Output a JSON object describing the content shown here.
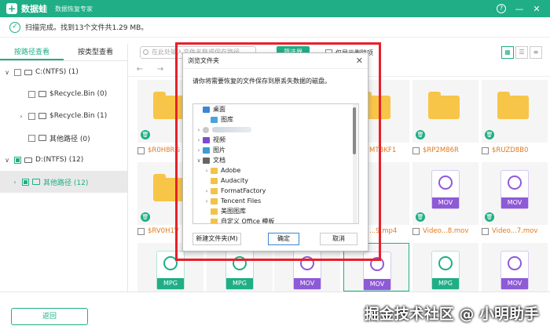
{
  "app": {
    "name": "数据蛙",
    "subtitle": "数据恢复专家",
    "logo_glyph": "+",
    "controls": {
      "help": "?",
      "minimize": "—",
      "close": "✕"
    }
  },
  "status": {
    "text": "扫描完成。找到13个文件共1.29 MB。"
  },
  "left_panel": {
    "tabs": [
      {
        "label": "按路径查看",
        "active": true
      },
      {
        "label": "按类型查看",
        "active": false
      }
    ],
    "tree": [
      {
        "label": "C:(NTFS) (1)",
        "chevron": "∨"
      },
      {
        "label": "$Recycle.Bin (0)",
        "chevron": ""
      },
      {
        "label": "$Recycle.Bin (1)",
        "chevron": "›"
      },
      {
        "label": "其他路径 (0)",
        "chevron": ""
      },
      {
        "label": "D:(NTFS) (12)",
        "chevron": "∨"
      },
      {
        "label": "其他路径 (12)",
        "chevron": "›"
      }
    ]
  },
  "toolbar": {
    "search_placeholder": "在此处输入文件名称或保存路径",
    "filter_label": "筛选器",
    "show_deleted_label": "仅显示删除项"
  },
  "files": {
    "row1": [
      "$R0H8RG",
      "MTBKF1",
      "$RP2M86R",
      "$RUZD8B0"
    ],
    "row2": [
      "$RV0H1V",
      "...9.mp4",
      "Video...8.mov",
      "Video...7.mov"
    ],
    "type_mov": "MOV",
    "type_mpg": "MPG"
  },
  "dialog": {
    "title": "浏览文件夹",
    "message": "请你将需要恢复的文件保存到原丢失数据的磁盘。",
    "tree": [
      {
        "label": "桌面",
        "chevron": "",
        "icon": "desktop"
      },
      {
        "label": "图库",
        "chevron": "",
        "icon": "pic"
      },
      {
        "label": "",
        "chevron": "›",
        "icon": "user"
      },
      {
        "label": "视频",
        "chevron": "›",
        "icon": "video"
      },
      {
        "label": "图片",
        "chevron": "›",
        "icon": "img"
      },
      {
        "label": "文档",
        "chevron": "∨",
        "icon": "doc"
      },
      {
        "label": "Adobe",
        "chevron": "›",
        "icon": "folder"
      },
      {
        "label": "Audacity",
        "chevron": "",
        "icon": "folder"
      },
      {
        "label": "FormatFactory",
        "chevron": "›",
        "icon": "folder"
      },
      {
        "label": "Tencent Files",
        "chevron": "›",
        "icon": "folder"
      },
      {
        "label": "美图图库",
        "chevron": "",
        "icon": "folder"
      },
      {
        "label": "自定义 Office 模板",
        "chevron": "",
        "icon": "folder"
      }
    ],
    "new_folder_label": "新建文件夹(M)",
    "ok_label": "确定",
    "cancel_label": "取消"
  },
  "bottom": {
    "back_label": "返回"
  },
  "watermark": "掘金技术社区 @ 小明助手"
}
